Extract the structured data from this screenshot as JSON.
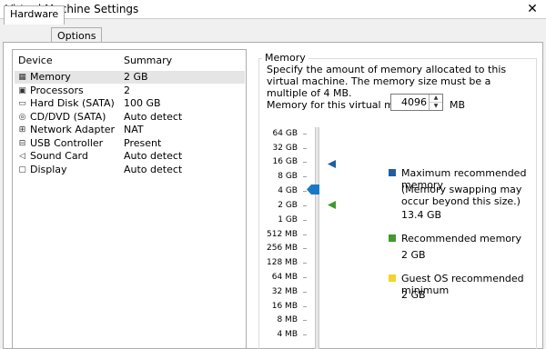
{
  "window": {
    "title": "Virtual Machine Settings"
  },
  "tabs": [
    {
      "label": "Hardware"
    },
    {
      "label": "Options"
    }
  ],
  "device_list": {
    "col_device": "Device",
    "col_summary": "Summary",
    "rows": [
      {
        "name": "Memory",
        "summary": "2 GB",
        "icon": "memory-icon"
      },
      {
        "name": "Processors",
        "summary": "2",
        "icon": "processor-icon"
      },
      {
        "name": "Hard Disk (SATA)",
        "summary": "100 GB",
        "icon": "hard-disk-icon"
      },
      {
        "name": "CD/DVD (SATA)",
        "summary": "Auto detect",
        "icon": "cd-dvd-icon"
      },
      {
        "name": "Network Adapter",
        "summary": "NAT",
        "icon": "network-adapter-icon"
      },
      {
        "name": "USB Controller",
        "summary": "Present",
        "icon": "usb-controller-icon"
      },
      {
        "name": "Sound Card",
        "summary": "Auto detect",
        "icon": "sound-card-icon"
      },
      {
        "name": "Display",
        "summary": "Auto detect",
        "icon": "display-icon"
      }
    ]
  },
  "memory": {
    "group_label": "Memory",
    "description": "Specify the amount of memory allocated to this virtual machine. The memory size must be a multiple of 4 MB.",
    "for_vm_label": "Memory for this virtual machine:",
    "value": "4096",
    "unit": "MB",
    "scale": [
      "64 GB",
      "32 GB",
      "16 GB",
      "8 GB",
      "4 GB",
      "2 GB",
      "1 GB",
      "512 MB",
      "256 MB",
      "128 MB",
      "64 MB",
      "32 MB",
      "16 MB",
      "8 MB",
      "4 MB"
    ],
    "slider_value": "4 GB",
    "legend": {
      "max_label": "Maximum recommended memory",
      "max_note": "(Memory swapping may occur beyond this size.)",
      "max_value": "13.4 GB",
      "rec_label": "Recommended memory",
      "rec_value": "2 GB",
      "guest_label": "Guest OS recommended minimum",
      "guest_value": "2 GB"
    },
    "colors": {
      "max": "#1f5fa0",
      "recommended": "#3f9a2f",
      "guest": "#f2d52a",
      "thumb": "#1a78c8"
    }
  }
}
